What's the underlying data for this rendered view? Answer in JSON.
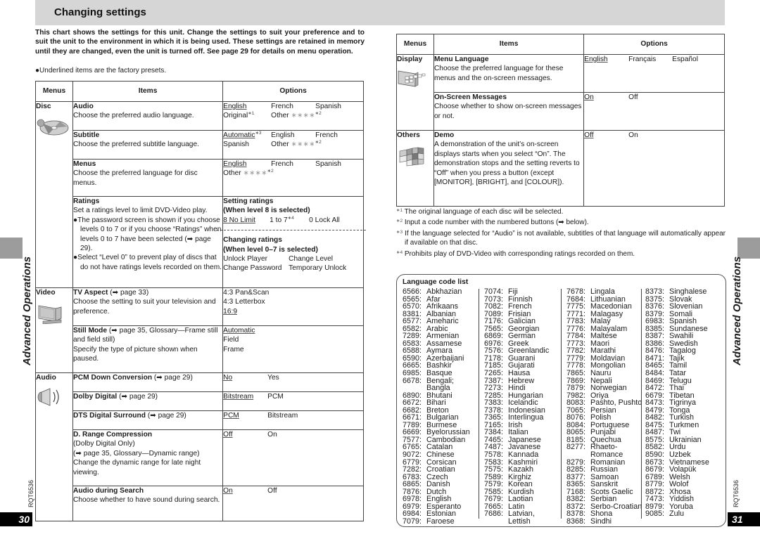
{
  "header": {
    "title": "Changing settings"
  },
  "intro": "This chart shows the settings for this unit. Change the settings to suit your preference and to suit the unit to the environment in which it is being used. These settings are retained in memory until they are changed, even the unit is turned off. See page 29 for details on menu operation.",
  "note": "●Underlined items are the factory presets.",
  "table_headers": {
    "menus": "Menus",
    "items": "Items",
    "options": "Options"
  },
  "left": {
    "disc": {
      "menu": "Disc",
      "icon": "disc-icon",
      "audio": {
        "title": "Audio",
        "desc": "Choose the preferred audio language.",
        "opts": [
          "English",
          "French",
          "Spanish",
          "Original",
          "Other"
        ],
        "sup1": "∗1",
        "stars": "∗∗∗∗",
        "sup2": "∗2"
      },
      "subtitle": {
        "title": "Subtitle",
        "desc": "Choose the preferred subtitle language.",
        "opts": [
          "Automatic",
          "English",
          "French",
          "Spanish",
          "Other"
        ],
        "sup3": "∗3",
        "stars": "∗∗∗∗",
        "sup2": "∗2"
      },
      "menus": {
        "title": "Menus",
        "desc": "Choose the preferred language for disc menus.",
        "opts": [
          "English",
          "French",
          "Spanish",
          "Other"
        ],
        "stars": "∗∗∗∗",
        "sup2": "∗2"
      },
      "ratings": {
        "title": "Ratings",
        "desc": "Set a ratings level to limit DVD-Video play.",
        "bullet1": "●The password screen is shown if you choose levels 0 to 7 or if you choose “Ratings” when levels 0 to 7 have been selected (➡ page 29).",
        "bullet2": "●Select “Level 0” to prevent play of discs that do not have ratings levels recorded on them.",
        "setting_title": "Setting ratings",
        "setting_sub": "(When level 8 is selected)",
        "setting_opts": [
          "8 No Limit",
          "1 to 7",
          "0 Lock All"
        ],
        "sup4": "∗4",
        "changing_title": "Changing ratings",
        "changing_sub": "(When level 0–7 is selected)",
        "changing_opts": [
          "Unlock Player",
          "Change Level",
          "Change Password",
          "Temporary Unlock"
        ]
      }
    },
    "video": {
      "menu": "Video",
      "icon": "tv-icon",
      "tv_aspect": {
        "title": "TV Aspect",
        "ref": " (➡ page 33)",
        "desc": "Choose the setting to suit your television and preference.",
        "opts": [
          "4:3 Pan&Scan",
          "4:3 Letterbox",
          "16:9"
        ]
      },
      "still_mode": {
        "title": "Still Mode",
        "ref": " (➡ page 35, Glossary—Frame still and field still)",
        "desc": "Specify the type of picture shown when paused.",
        "opts": [
          "Automatic",
          "Field",
          "Frame"
        ]
      }
    },
    "audio": {
      "menu": "Audio",
      "icon": "speaker-icon",
      "pcm": {
        "title": "PCM Down Conversion",
        "ref": " (➡ page 29)",
        "opts": [
          "No",
          "Yes"
        ]
      },
      "dolby": {
        "title": "Dolby Digital",
        "ref": " (➡ page 29)",
        "opts": [
          "Bitstream",
          "PCM"
        ]
      },
      "dts": {
        "title": "DTS Digital Surround",
        "ref": " (➡ page 29)",
        "opts": [
          "PCM",
          "Bitstream"
        ]
      },
      "drc": {
        "title": "D. Range Compression",
        "line1": "(Dolby Digital Only)",
        "line2": "(➡ page 35, Glossary—Dynamic range)",
        "desc": "Change the dynamic range for late night viewing.",
        "opts": [
          "Off",
          "On"
        ]
      },
      "search": {
        "title": "Audio during Search",
        "desc": "Choose whether to have sound during search.",
        "opts": [
          "On",
          "Off"
        ]
      }
    }
  },
  "right": {
    "display": {
      "menu": "Display",
      "icon": "display-icon",
      "menu_language": {
        "title": "Menu Language",
        "desc": "Choose the preferred language for these menus and the on-screen messages.",
        "opts": [
          "English",
          "Français",
          "Español"
        ]
      },
      "osm": {
        "title": "On-Screen Messages",
        "desc": "Choose whether to show on-screen messages or not.",
        "opts": [
          "On",
          "Off"
        ]
      }
    },
    "others": {
      "menu": "Others",
      "icon": "mosaic-icon",
      "demo": {
        "title": "Demo",
        "desc": "A demonstration of the unit’s on-screen displays starts when you select “On”. The demonstration stops and the setting reverts to “Off” when you press a button (except [MONITOR], [BRIGHT], and [COLOUR]).",
        "opts": [
          "Off",
          "On"
        ]
      }
    }
  },
  "footnotes": [
    {
      "mark": "∗1",
      "text": " The original language of each disc will be selected."
    },
    {
      "mark": "∗2",
      "text": " Input a code number with the numbered buttons (➡ below)."
    },
    {
      "mark": "∗3",
      "text": " If the language selected for “Audio” is not available, subtitles of that language will automatically appear if available on that disc."
    },
    {
      "mark": "∗4",
      "text": " Prohibits play of DVD-Video with corresponding ratings recorded on them."
    }
  ],
  "language_list": {
    "title": "Language code list",
    "columns": [
      [
        [
          "6566:",
          "Abkhazian"
        ],
        [
          "6565:",
          "Afar"
        ],
        [
          "6570:",
          "Afrikaans"
        ],
        [
          "8381:",
          "Albanian"
        ],
        [
          "6577:",
          "Ameharic"
        ],
        [
          "6582:",
          "Arabic"
        ],
        [
          "7289:",
          "Armenian"
        ],
        [
          "6583:",
          "Assamese"
        ],
        [
          "6588:",
          "Aymara"
        ],
        [
          "6590:",
          "Azerbaijani"
        ],
        [
          "6665:",
          "Bashkir"
        ],
        [
          "6985:",
          "Basque"
        ],
        [
          "6678:",
          "Bengali;"
        ],
        [
          "",
          "Bangla"
        ],
        [
          "6890:",
          "Bhutani"
        ],
        [
          "6672:",
          "Bihari"
        ],
        [
          "6682:",
          "Breton"
        ],
        [
          "6671:",
          "Bulgarian"
        ],
        [
          "7789:",
          "Burmese"
        ],
        [
          "6669:",
          "Byelorussian"
        ],
        [
          "7577:",
          "Cambodian"
        ],
        [
          "6765:",
          "Catalan"
        ],
        [
          "9072:",
          "Chinese"
        ],
        [
          "6779:",
          "Corsican"
        ],
        [
          "7282:",
          "Croatian"
        ],
        [
          "6783:",
          "Czech"
        ],
        [
          "6865:",
          "Danish"
        ],
        [
          "7876:",
          "Dutch"
        ],
        [
          "6978:",
          "English"
        ],
        [
          "6979:",
          "Esperanto"
        ],
        [
          "6984:",
          "Estonian"
        ],
        [
          "7079:",
          "Faroese"
        ]
      ],
      [
        [
          "7074:",
          "Fiji"
        ],
        [
          "7073:",
          "Finnish"
        ],
        [
          "7082:",
          "French"
        ],
        [
          "7089:",
          "Frisian"
        ],
        [
          "7176:",
          "Galician"
        ],
        [
          "7565:",
          "Georgian"
        ],
        [
          "6869:",
          "German"
        ],
        [
          "6976:",
          "Greek"
        ],
        [
          "7576:",
          "Greenlandic"
        ],
        [
          "7178:",
          "Guarani"
        ],
        [
          "7185:",
          "Gujarati"
        ],
        [
          "7265:",
          "Hausa"
        ],
        [
          "7387:",
          "Hebrew"
        ],
        [
          "7273:",
          "Hindi"
        ],
        [
          "7285:",
          "Hungarian"
        ],
        [
          "7383:",
          "Icelandic"
        ],
        [
          "7378:",
          "Indonesian"
        ],
        [
          "7365:",
          "Interlingua"
        ],
        [
          "7165:",
          "Irish"
        ],
        [
          "7384:",
          "Italian"
        ],
        [
          "7465:",
          "Japanese"
        ],
        [
          "7487:",
          "Javanese"
        ],
        [
          "7578:",
          "Kannada"
        ],
        [
          "7583:",
          "Kashmiri"
        ],
        [
          "7575:",
          "Kazakh"
        ],
        [
          "7589:",
          "Kirghiz"
        ],
        [
          "7579:",
          "Korean"
        ],
        [
          "7585:",
          "Kurdish"
        ],
        [
          "7679:",
          "Laotian"
        ],
        [
          "7665:",
          "Latin"
        ],
        [
          "7686:",
          "Latvian,"
        ],
        [
          "",
          "Lettish"
        ]
      ],
      [
        [
          "7678:",
          "Lingala"
        ],
        [
          "7684:",
          "Lithuanian"
        ],
        [
          "7775:",
          "Macedonian"
        ],
        [
          "7771:",
          "Malagasy"
        ],
        [
          "7783:",
          "Malay"
        ],
        [
          "7776:",
          "Malayalam"
        ],
        [
          "7784:",
          "Maltese"
        ],
        [
          "7773:",
          "Maori"
        ],
        [
          "7782:",
          "Marathi"
        ],
        [
          "7779:",
          "Moldavian"
        ],
        [
          "7778:",
          "Mongolian"
        ],
        [
          "7865:",
          "Nauru"
        ],
        [
          "7869:",
          "Nepali"
        ],
        [
          "7879:",
          "Norwegian"
        ],
        [
          "7982:",
          "Oriya"
        ],
        [
          "8083:",
          "Pashto, Pushto"
        ],
        [
          "7065:",
          "Persian"
        ],
        [
          "8076:",
          "Polish"
        ],
        [
          "8084:",
          "Portuguese"
        ],
        [
          "8065:",
          "Punjabi"
        ],
        [
          "8185:",
          "Quechua"
        ],
        [
          "8277:",
          "Rhaeto-"
        ],
        [
          "",
          "Romance"
        ],
        [
          "8279:",
          "Romanian"
        ],
        [
          "8285:",
          "Russian"
        ],
        [
          "8377:",
          "Samoan"
        ],
        [
          "8365:",
          "Sanskrit"
        ],
        [
          "7168:",
          "Scots Gaelic"
        ],
        [
          "8382:",
          "Serbian"
        ],
        [
          "8372:",
          "Serbo-Croatian"
        ],
        [
          "8378:",
          "Shona"
        ],
        [
          "8368:",
          "Sindhi"
        ]
      ],
      [
        [
          "8373:",
          "Singhalese"
        ],
        [
          "8375:",
          "Slovak"
        ],
        [
          "8376:",
          "Slovenian"
        ],
        [
          "8379:",
          "Somali"
        ],
        [
          "6983:",
          "Spanish"
        ],
        [
          "8385:",
          "Sundanese"
        ],
        [
          "8387:",
          "Swahili"
        ],
        [
          "8386:",
          "Swedish"
        ],
        [
          "8476:",
          "Tagalog"
        ],
        [
          "8471:",
          "Tajik"
        ],
        [
          "8465:",
          "Tamil"
        ],
        [
          "8484:",
          "Tatar"
        ],
        [
          "8469:",
          "Telugu"
        ],
        [
          "8472:",
          "Thai"
        ],
        [
          "6679:",
          "Tibetan"
        ],
        [
          "8473:",
          "Tigrinya"
        ],
        [
          "8479:",
          "Tonga"
        ],
        [
          "8482:",
          "Turkish"
        ],
        [
          "8475:",
          "Turkmen"
        ],
        [
          "8487:",
          "Twi"
        ],
        [
          "8575:",
          "Ukrainian"
        ],
        [
          "8582:",
          "Urdu"
        ],
        [
          "8590:",
          "Uzbek"
        ],
        [
          "8673:",
          "Vietnamese"
        ],
        [
          "8679:",
          "Volapük"
        ],
        [
          "6789:",
          "Welsh"
        ],
        [
          "8779:",
          "Wolof"
        ],
        [
          "8872:",
          "Xhosa"
        ],
        [
          "7473:",
          "Yiddish"
        ],
        [
          "8979:",
          "Yoruba"
        ],
        [
          "9085:",
          "Zulu"
        ]
      ]
    ]
  },
  "margins": {
    "section_label": "Advanced Operations",
    "doc_code": "RQT6536",
    "left_page": "30",
    "right_page": "31"
  }
}
